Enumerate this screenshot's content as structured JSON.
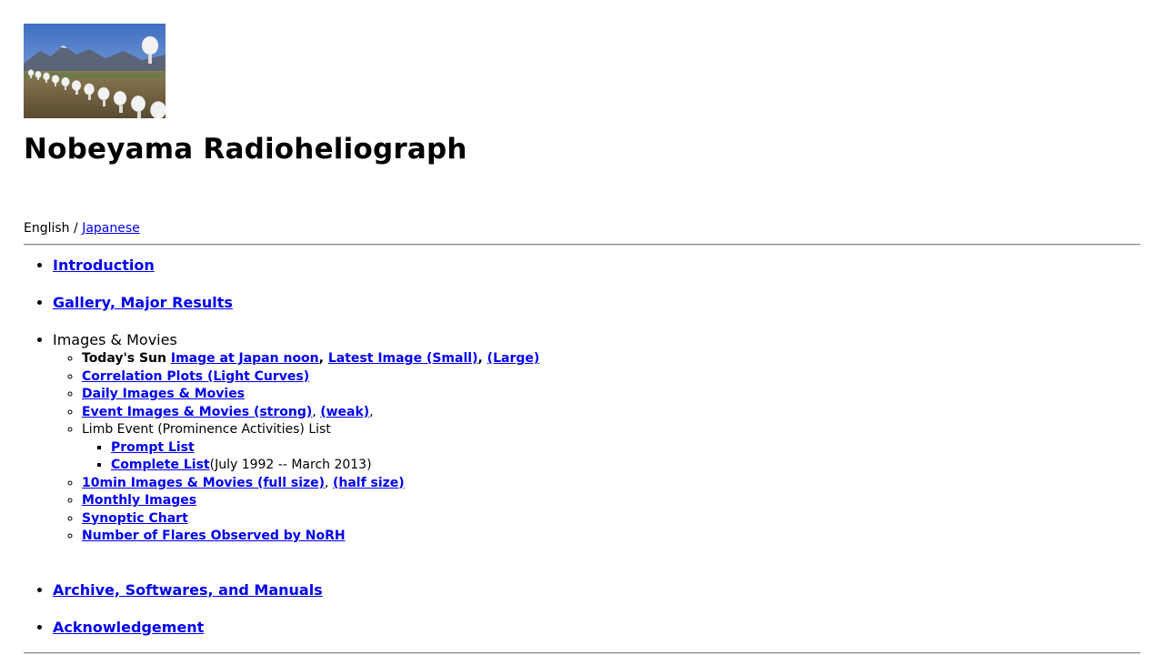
{
  "header": {
    "banner_alt": "Nobeyama Radioheliograph antenna array",
    "title": "Nobeyama Radioheliograph"
  },
  "language": {
    "current": "English",
    "separator": " / ",
    "other_link": "Japanese"
  },
  "nav": {
    "introduction": "Introduction",
    "gallery": "Gallery, Major Results",
    "images_movies": {
      "heading": "Images & Movies",
      "todays_sun": {
        "label": "Today's Sun ",
        "link_noon": "Image at Japan noon",
        "link_latest_small": "Latest Image (Small)",
        "link_large": "(Large)"
      },
      "correlation_plots": "Correlation Plots (Light Curves)",
      "daily_images": "Daily Images & Movies",
      "event_images": {
        "strong": "Event Images & Movies (strong)",
        "weak": "(weak)"
      },
      "limb_event": {
        "label": "Limb Event (Prominence Activities) List",
        "prompt_list": "Prompt List",
        "complete_list": "Complete List",
        "complete_list_note": "(July 1992 -- March 2013)"
      },
      "ten_min": {
        "full": "10min Images & Movies (full size)",
        "half": "(half size)"
      },
      "monthly_images": "Monthly Images",
      "synoptic_chart": "Synoptic Chart",
      "flare_count": "Number of Flares Observed by NoRH"
    },
    "archive": "Archive, Softwares, and Manuals",
    "acknowledgement": "Acknowledgement"
  },
  "punctuation": {
    "comma": ", ",
    "trailing_comma": ","
  },
  "colors": {
    "link": "#0000ee",
    "text": "#000000",
    "rule": "#888888"
  }
}
